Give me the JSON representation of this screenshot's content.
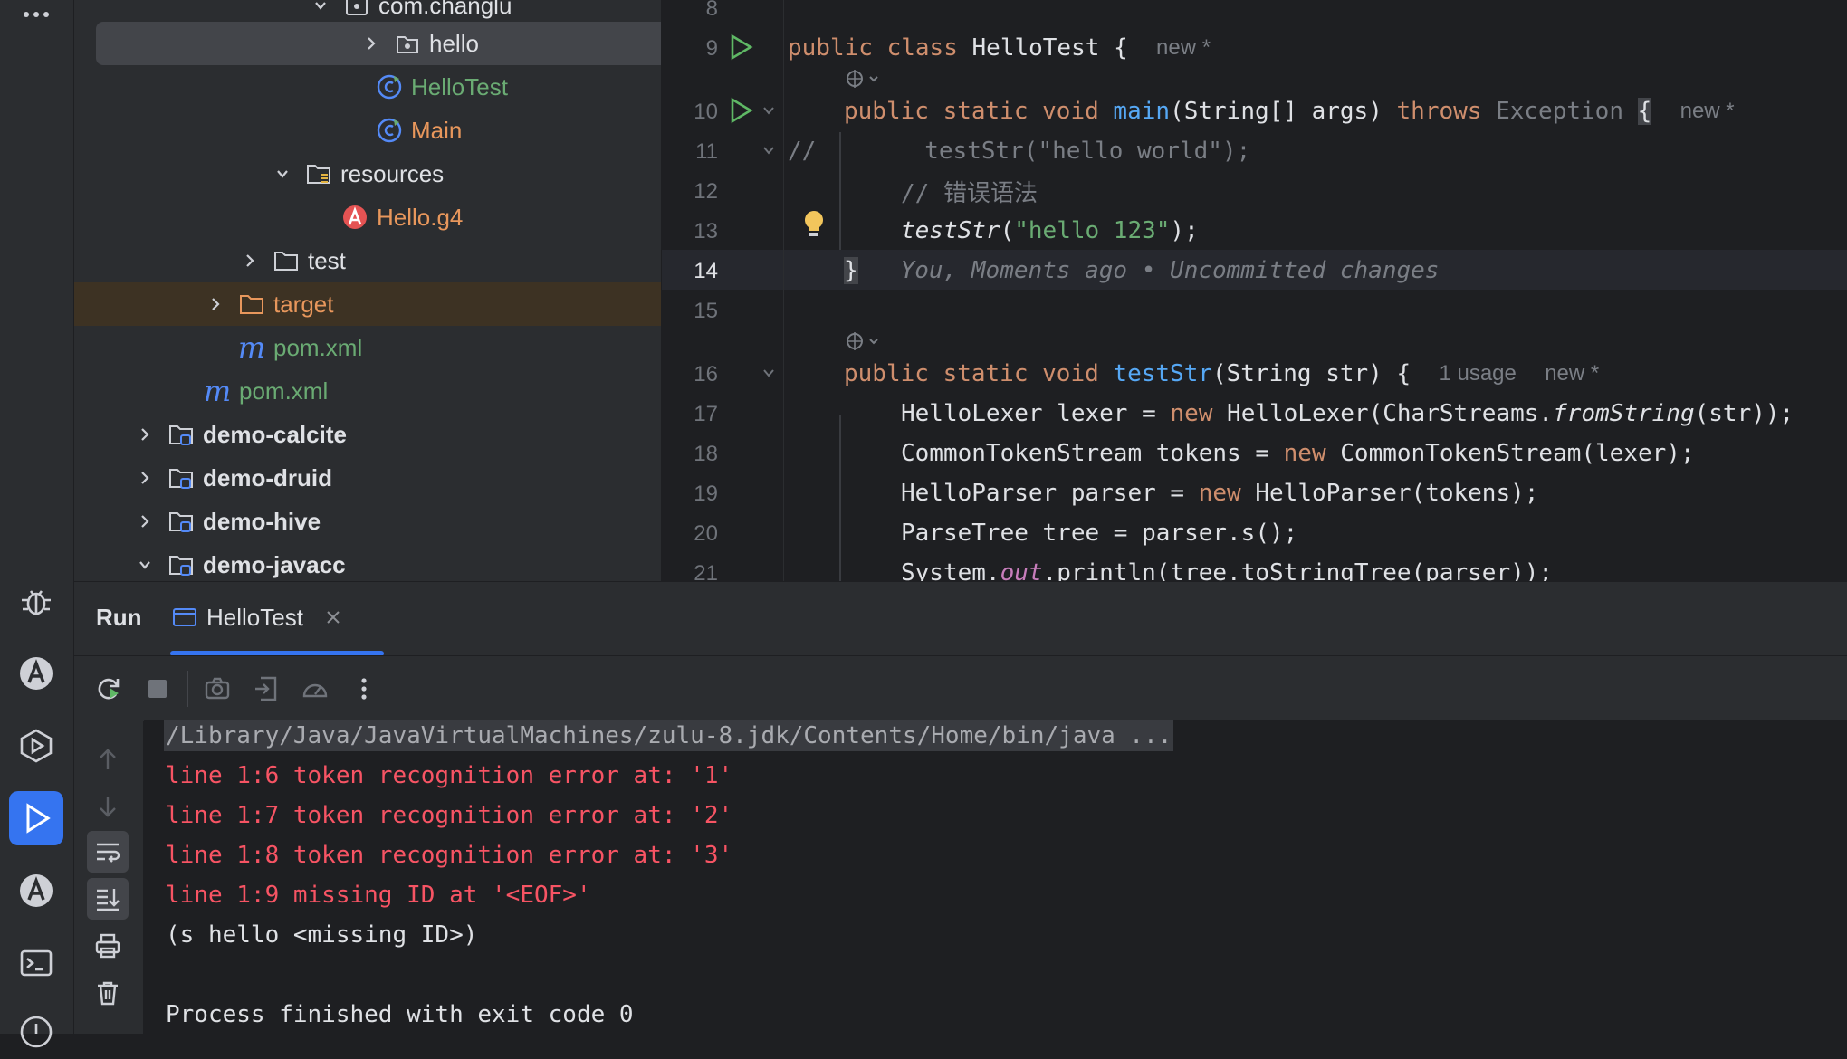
{
  "activity_bar": {
    "icons": [
      "more-icon",
      "debug-icon",
      "antlr-icon",
      "services-icon",
      "run-icon",
      "antlr-preview-icon",
      "terminal-icon",
      "problems-icon"
    ]
  },
  "project_tree": {
    "items": [
      {
        "label": "com.changlu",
        "color": "#dfe1e5"
      },
      {
        "label": "hello",
        "color": "#dfe1e5"
      },
      {
        "label": "HelloTest",
        "color": "#6aab73"
      },
      {
        "label": "Main",
        "color": "#e8975c"
      },
      {
        "label": "resources",
        "color": "#dfe1e5"
      },
      {
        "label": "Hello.g4",
        "color": "#e8975c"
      },
      {
        "label": "test",
        "color": "#dfe1e5"
      },
      {
        "label": "target",
        "color": "#e8975c"
      },
      {
        "label": "pom.xml",
        "color": "#6aab73"
      },
      {
        "label": "pom.xml",
        "color": "#6aab73"
      },
      {
        "label": "demo-calcite",
        "color": "#dfe1e5"
      },
      {
        "label": "demo-druid",
        "color": "#dfe1e5"
      },
      {
        "label": "demo-hive",
        "color": "#dfe1e5"
      },
      {
        "label": "demo-javacc",
        "color": "#dfe1e5"
      }
    ]
  },
  "editor": {
    "line_numbers": [
      "8",
      "9",
      "10",
      "11",
      "12",
      "13",
      "14",
      "15",
      "16",
      "17",
      "18",
      "19",
      "20",
      "21"
    ],
    "line9": {
      "kw1": "public",
      "kw2": "class",
      "name": "HelloTest",
      "brace": "{",
      "hint": "new *"
    },
    "line10": {
      "kw": "public static void",
      "fn": "main",
      "params": "(String[] args)",
      "throws": "throws",
      "exc": "Exception",
      "brace": "{",
      "hint": "new *"
    },
    "line11": {
      "prefix": "//",
      "code": "      testStr(\"hello world\");"
    },
    "line12": {
      "comment": "// 错误语法"
    },
    "line13": {
      "fn": "testStr",
      "open": "(",
      "str": "\"hello 123\"",
      "close": ");"
    },
    "line14": {
      "brace": "}",
      "blame": "You, Moments ago • Uncommitted changes"
    },
    "line16": {
      "kw": "public static void",
      "fn": "testStr",
      "params": "(String str) {",
      "usage": "1 usage",
      "hint": "new *"
    },
    "line17": {
      "a": "HelloLexer lexer = ",
      "new": "new",
      "b": " HelloLexer(CharStreams.",
      "m": "fromString",
      "c": "(str));"
    },
    "line18": {
      "a": "CommonTokenStream tokens = ",
      "new": "new",
      "b": " CommonTokenStream(lexer);"
    },
    "line19": {
      "a": "HelloParser parser = ",
      "new": "new",
      "b": " HelloParser(tokens);"
    },
    "line20": {
      "a": "ParseTree tree = parser.s();"
    },
    "line21": {
      "a": "System.",
      "f": "out",
      "b": ".println(tree.toStringTree(parser));"
    }
  },
  "run_panel": {
    "title": "Run",
    "tab_label": "HelloTest",
    "console": {
      "command": "/Library/Java/JavaVirtualMachines/zulu-8.jdk/Contents/Home/bin/java ...",
      "errors": [
        "line 1:6 token recognition error at: '1'",
        "line 1:7 token recognition error at: '2'",
        "line 1:8 token recognition error at: '3'",
        "line 1:9 missing ID at '<EOF>'"
      ],
      "output": "(s hello <missing ID>)",
      "exit": "Process finished with exit code 0"
    }
  },
  "colors": {
    "accent": "#3574f0",
    "error": "#f75464",
    "string": "#6aab73",
    "keyword": "#cf8e6d",
    "function": "#56a8f5"
  }
}
